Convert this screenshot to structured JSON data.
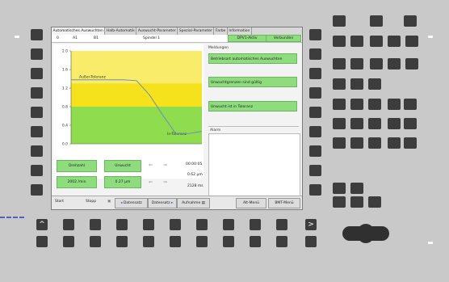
{
  "tabs": [
    {
      "label": "Automatisches Auswuchten",
      "active": true
    },
    {
      "label": "Halb-Automatik",
      "active": false
    },
    {
      "label": "Auswucht-Parameter",
      "active": false
    },
    {
      "label": "Spezial-Parameter",
      "active": false
    },
    {
      "label": "Farbe",
      "active": false
    },
    {
      "label": "Information",
      "active": false
    }
  ],
  "info_bar": {
    "col0": "0",
    "col1": "A1",
    "col2": "B1",
    "spindle": "Spindel 1",
    "status1": "DPV1-Aktiv",
    "status2": "Verbunden"
  },
  "chart_data": {
    "type": "line",
    "y_ticks": [
      "2.0",
      "1.6",
      "1.2",
      "0.8",
      "0.4",
      "0.0"
    ],
    "ylim": [
      0,
      2.0
    ],
    "zones": [
      {
        "label": "Außer-Toleranz",
        "from": 0.8,
        "to": 2.0,
        "color": "#f6e21c"
      },
      {
        "label": "In-Toleranz",
        "from": 0,
        "to": 0.8,
        "color": "#8fdc4f"
      }
    ],
    "series": [
      {
        "x": [
          0,
          1,
          2,
          3,
          4,
          5,
          6,
          7,
          8,
          9,
          10
        ],
        "values": [
          1.38,
          1.38,
          1.38,
          1.38,
          1.38,
          1.36,
          1.05,
          0.62,
          0.22,
          0.22,
          0.27
        ],
        "color": "#6f8fb8"
      }
    ]
  },
  "messages": {
    "header": "Meldungen",
    "items": [
      "Betriebsart automatisches Auswuchten",
      "Unwuchtgrenzen sind gültig",
      "Unwucht ist in Toleranz"
    ],
    "alarm_header": "Alarm"
  },
  "values": {
    "speed_label": "Drehzahl",
    "unbalance_label": "Unwucht",
    "speed": "2002 /min",
    "unbalance": "0.27 µm",
    "time": "00:00:05",
    "val2": "0.62 µm",
    "val3": "2128 ms"
  },
  "bottom_bar": {
    "start": "Start",
    "stop": "Stopp",
    "datensatz1": "Datensatz",
    "datensatz2": "Datensatz",
    "aufnahme": "Aufnahme",
    "alt_menu": "Alt-Menü",
    "bmt_menu": "BMT-Menü"
  },
  "hw": {
    "up_arrow": "^",
    "right_arrow": ">"
  }
}
